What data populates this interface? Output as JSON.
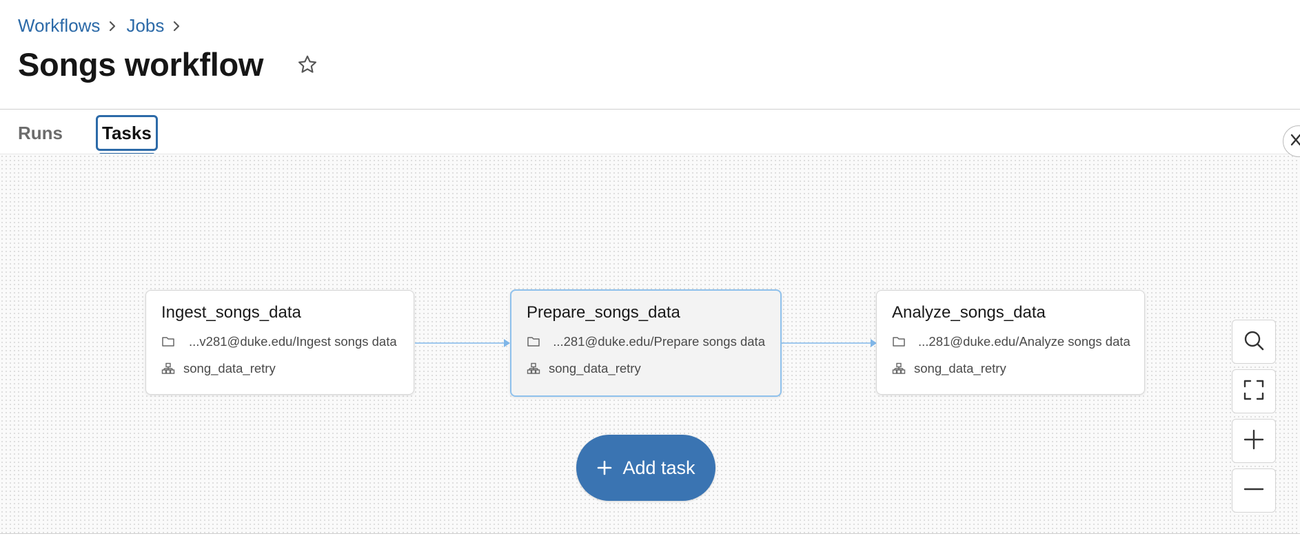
{
  "breadcrumb": {
    "items": [
      "Workflows",
      "Jobs"
    ]
  },
  "header": {
    "title": "Songs workflow"
  },
  "tabs": [
    {
      "label": "Runs",
      "active": false
    },
    {
      "label": "Tasks",
      "active": true
    }
  ],
  "tasks": [
    {
      "name": "Ingest_songs_data",
      "path": "...v281@duke.edu/Ingest songs data",
      "cluster": "song_data_retry",
      "selected": false
    },
    {
      "name": "Prepare_songs_data",
      "path": "...281@duke.edu/Prepare songs data",
      "cluster": "song_data_retry",
      "selected": true
    },
    {
      "name": "Analyze_songs_data",
      "path": "...281@duke.edu/Analyze songs data",
      "cluster": "song_data_retry",
      "selected": false
    }
  ],
  "add_task": {
    "label": "Add task"
  },
  "colors": {
    "accent": "#3a74b2",
    "link": "#2c6aa8",
    "edge": "#9ec8ee",
    "selected_border": "#8fc1ec"
  },
  "icons": {
    "breadcrumb_separator": "chevron-right-icon",
    "favorite": "star-icon",
    "path": "folder-icon",
    "cluster": "cluster-icon",
    "search": "search-icon",
    "fit_view": "fit-view-icon",
    "zoom_in": "zoom-in-icon",
    "zoom_out": "zoom-out-icon",
    "collapse": "close-icon"
  }
}
